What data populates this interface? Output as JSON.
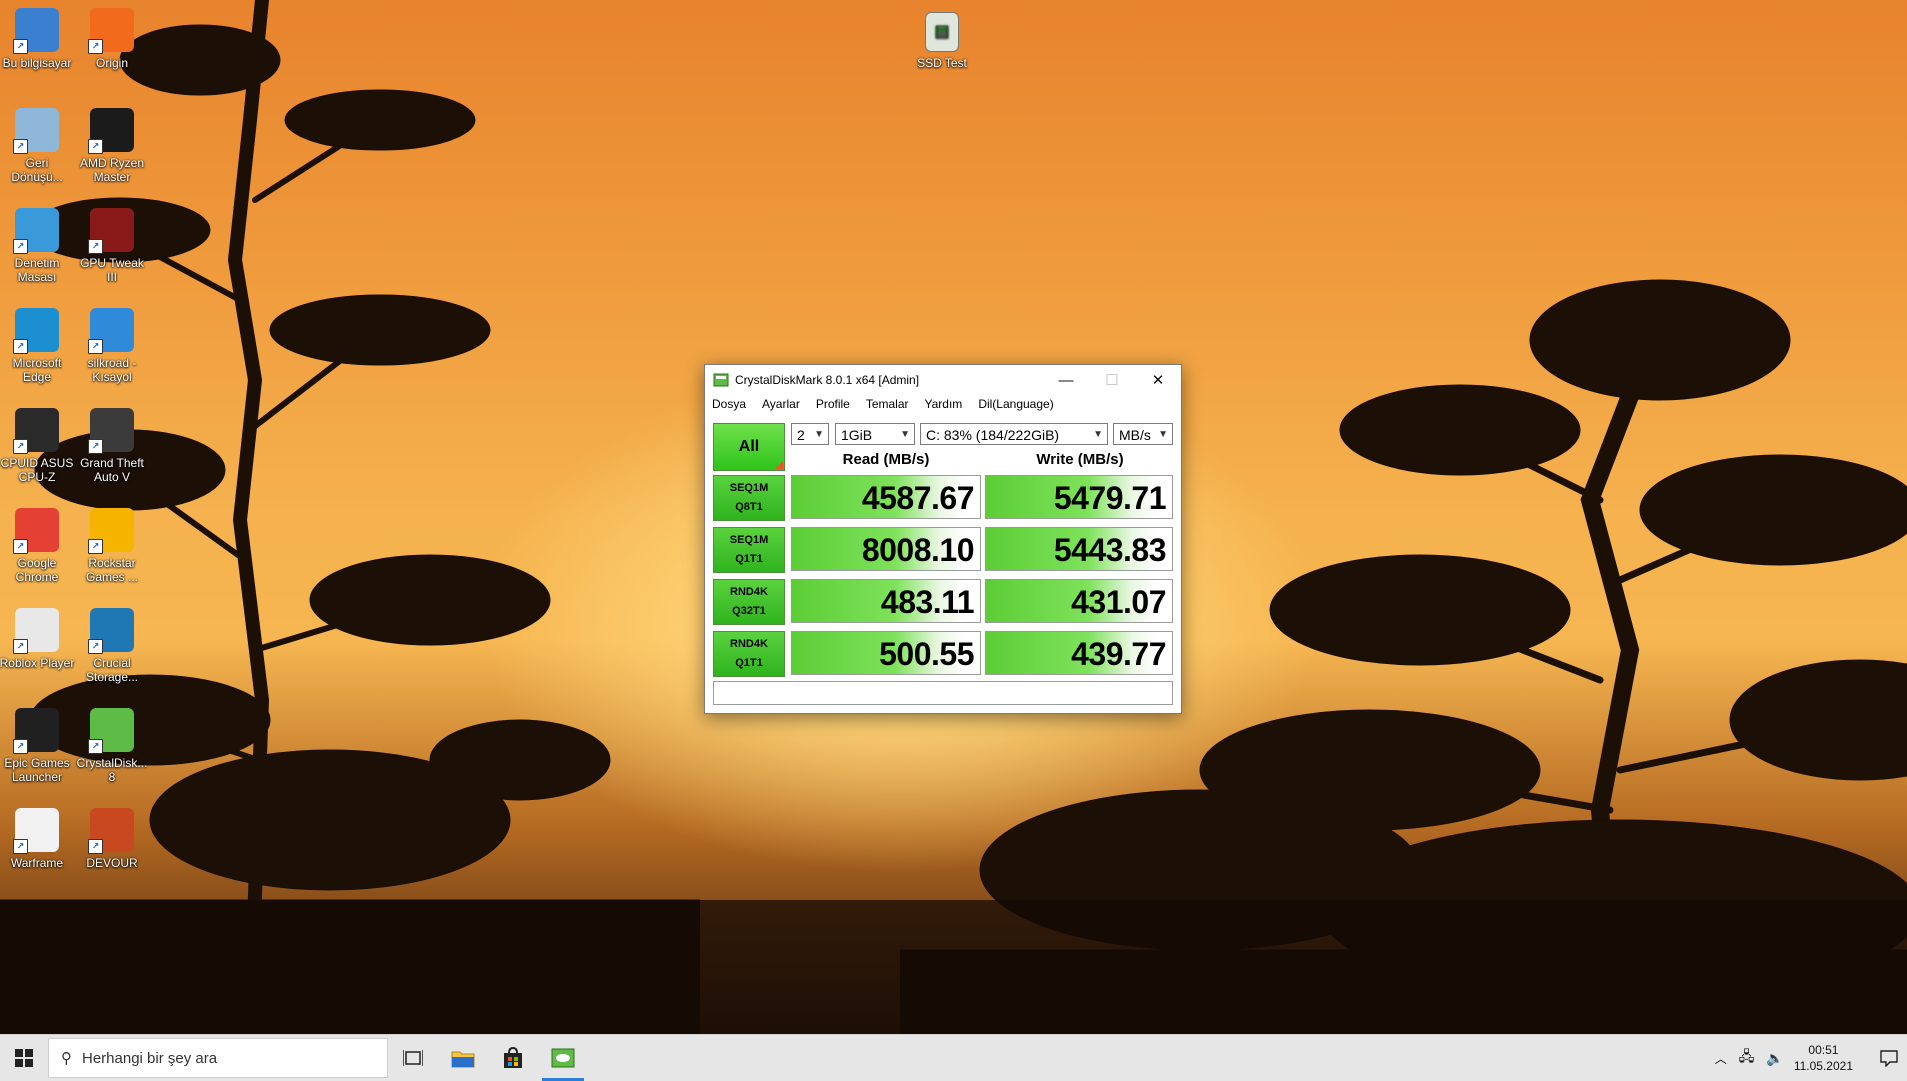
{
  "desktop": {
    "icons": [
      {
        "label": "Bu bilgisayar",
        "icon": "computer-icon",
        "color": "#3a7fd0"
      },
      {
        "label": "Origin",
        "icon": "origin-icon",
        "color": "#f26a1b"
      },
      {
        "label": "Geri Dönüşü...",
        "icon": "recycle-bin-icon",
        "color": "#8fb7da"
      },
      {
        "label": "AMD Ryzen Master",
        "icon": "amd-ryzen-icon",
        "color": "#1b1b1b"
      },
      {
        "label": "Denetim Masası",
        "icon": "control-panel-icon",
        "color": "#3a9ad9"
      },
      {
        "label": "GPU Tweak III",
        "icon": "gpu-tweak-icon",
        "color": "#8a1a1a"
      },
      {
        "label": "Microsoft Edge",
        "icon": "edge-icon",
        "color": "#1c8fd1"
      },
      {
        "label": "silkroad - Kısayol",
        "icon": "silkroad-icon",
        "color": "#2f8ad9"
      },
      {
        "label": "CPUID ASUS CPU-Z",
        "icon": "cpuz-icon",
        "color": "#2a2a2a"
      },
      {
        "label": "Grand Theft Auto V",
        "icon": "gta-icon",
        "color": "#3b3b3b"
      },
      {
        "label": "Google Chrome",
        "icon": "chrome-icon",
        "color": "#e44134"
      },
      {
        "label": "Rockstar Games ...",
        "icon": "rockstar-icon",
        "color": "#f4b400"
      },
      {
        "label": "Roblox Player",
        "icon": "roblox-icon",
        "color": "#e8e8e8"
      },
      {
        "label": "Crucial Storage...",
        "icon": "crucial-icon",
        "color": "#1f78b4"
      },
      {
        "label": "Epic Games Launcher",
        "icon": "epic-games-icon",
        "color": "#202020"
      },
      {
        "label": "CrystalDisk... 8",
        "icon": "crystaldisk-icon",
        "color": "#5dbb46"
      },
      {
        "label": "Warframe",
        "icon": "warframe-icon",
        "color": "#f2f2f2"
      },
      {
        "label": "DEVOUR",
        "icon": "devour-icon",
        "color": "#c8491f"
      }
    ],
    "ssd_test": {
      "label": "SSD Test",
      "icon": "ssd-test-icon"
    }
  },
  "window": {
    "title": "CrystalDiskMark 8.0.1 x64 [Admin]",
    "menu": [
      "Dosya",
      "Ayarlar",
      "Profile",
      "Temalar",
      "Yardım",
      "Dil(Language)"
    ],
    "all_label": "All",
    "count": "2",
    "size": "1GiB",
    "drive": "C: 83% (184/222GiB)",
    "unit": "MB/s",
    "read_header": "Read (MB/s)",
    "write_header": "Write (MB/s)",
    "rows": [
      {
        "l1": "SEQ1M",
        "l2": "Q8T1",
        "read": "4587.67",
        "write": "5479.71"
      },
      {
        "l1": "SEQ1M",
        "l2": "Q1T1",
        "read": "8008.10",
        "write": "5443.83"
      },
      {
        "l1": "RND4K",
        "l2": "Q32T1",
        "read": "483.11",
        "write": "431.07"
      },
      {
        "l1": "RND4K",
        "l2": "Q1T1",
        "read": "500.55",
        "write": "439.77"
      }
    ],
    "comment": ""
  },
  "taskbar": {
    "search_placeholder": "Herhangi bir şey ara",
    "time": "00:51",
    "date": "11.05.2021",
    "accent": "#2b7fd6"
  }
}
